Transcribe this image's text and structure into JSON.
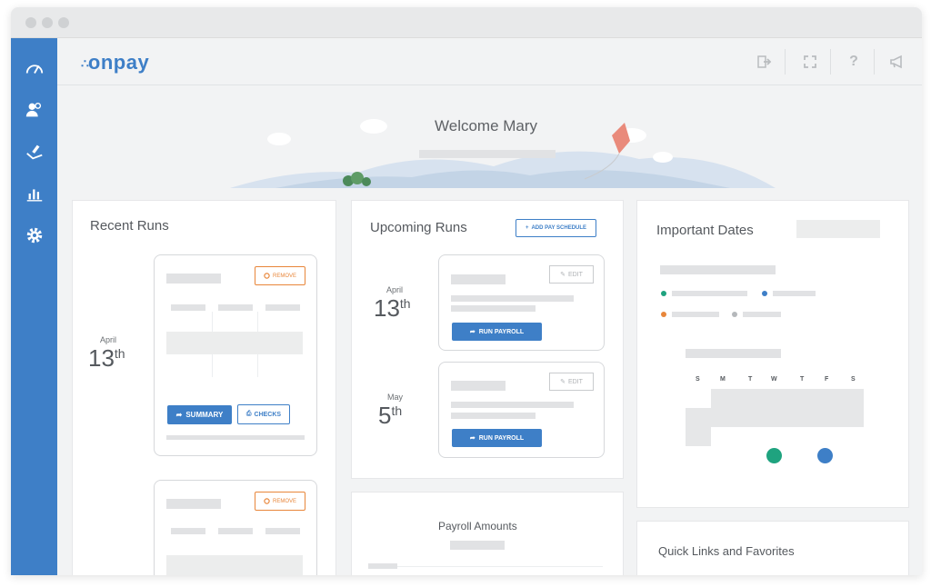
{
  "app": {
    "brand": "onpay",
    "brand_dots": "∴"
  },
  "sidebar": {
    "items": [
      {
        "icon": "dashboard-gauge-icon"
      },
      {
        "icon": "people-icon"
      },
      {
        "icon": "payroll-hand-icon"
      },
      {
        "icon": "reports-chart-icon"
      },
      {
        "icon": "settings-gear-icon"
      }
    ]
  },
  "topbar": {
    "icons": [
      "logout-icon",
      "expand-icon",
      "help-icon",
      "announcements-icon"
    ],
    "help_glyph": "?"
  },
  "hero": {
    "welcome": "Welcome Mary"
  },
  "recent_runs": {
    "title": "Recent Runs",
    "run1": {
      "month": "April",
      "day": "13",
      "suffix": "th",
      "remove_label": "REMOVE",
      "summary_label": "SUMMARY",
      "checks_label": "CHECKS"
    },
    "run2": {
      "remove_label": "REMOVE"
    }
  },
  "upcoming_runs": {
    "title": "Upcoming Runs",
    "add_schedule_label": "ADD PAY SCHEDULE",
    "runs": [
      {
        "month": "April",
        "day": "13",
        "suffix": "th",
        "edit_label": "EDIT",
        "run_label": "RUN PAYROLL"
      },
      {
        "month": "May",
        "day": "5",
        "suffix": "th",
        "edit_label": "EDIT",
        "run_label": "RUN PAYROLL"
      }
    ]
  },
  "payroll_amounts": {
    "title": "Payroll Amounts"
  },
  "important_dates": {
    "title": "Important Dates",
    "weekdays": [
      "S",
      "M",
      "T",
      "W",
      "T",
      "F",
      "S"
    ],
    "colors": {
      "teal": "#1fa37f",
      "blue": "#3e7fc7",
      "orange": "#e8863a",
      "gray": "#b5b8bb"
    }
  },
  "quick_links": {
    "title": "Quick Links and Favorites"
  }
}
